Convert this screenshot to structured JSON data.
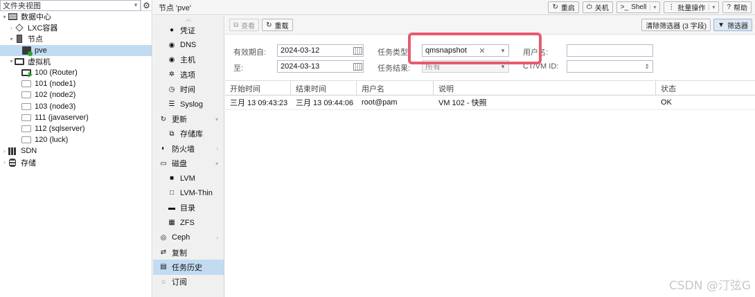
{
  "tree": {
    "view_select": "文件夹视图",
    "nodes": [
      {
        "label": "数据中心",
        "level": 0,
        "icon": "datacenter-icon",
        "expander": "▾"
      },
      {
        "label": "LXC容器",
        "level": 1,
        "icon": "container-icon",
        "expander": "›"
      },
      {
        "label": "节点",
        "level": 1,
        "icon": "server-icon",
        "expander": "▾"
      },
      {
        "label": "pve",
        "level": 2,
        "icon": "node-online-icon",
        "expander": ""
      },
      {
        "label": "虚拟机",
        "level": 1,
        "icon": "monitor-icon",
        "expander": "▾"
      },
      {
        "label": "100 (Router)",
        "level": 2,
        "icon": "vm-running-icon",
        "expander": ""
      },
      {
        "label": "101 (node1)",
        "level": 2,
        "icon": "vm-icon",
        "expander": ""
      },
      {
        "label": "102 (node2)",
        "level": 2,
        "icon": "vm-icon",
        "expander": ""
      },
      {
        "label": "103 (node3)",
        "level": 2,
        "icon": "vm-icon",
        "expander": ""
      },
      {
        "label": "111 (javaserver)",
        "level": 2,
        "icon": "vm-icon",
        "expander": ""
      },
      {
        "label": "112 (sqlserver)",
        "level": 2,
        "icon": "vm-icon",
        "expander": ""
      },
      {
        "label": "120 (luck)",
        "level": 2,
        "icon": "vm-icon",
        "expander": ""
      },
      {
        "label": "SDN",
        "level": 0,
        "icon": "sdn-icon",
        "expander": "›"
      },
      {
        "label": "存储",
        "level": 0,
        "icon": "storage-icon",
        "expander": "›"
      }
    ],
    "selected": "pve"
  },
  "topbar": {
    "title": "节点 'pve'",
    "buttons": [
      {
        "label": "重启",
        "icon": "restart-icon",
        "glyph": "↻"
      },
      {
        "label": "关机",
        "icon": "power-icon",
        "glyph": "⏻"
      },
      {
        "label": "Shell",
        "icon": "terminal-icon",
        "glyph": ">_"
      },
      {
        "label": "批量操作",
        "icon": "bulk-icon",
        "glyph": "⋮"
      },
      {
        "label": "帮助",
        "icon": "help-icon",
        "glyph": "?"
      }
    ]
  },
  "menu": {
    "items": [
      {
        "label": "凭证",
        "icon": "certificate-icon",
        "glyph": "●",
        "level": 1
      },
      {
        "label": "DNS",
        "icon": "globe-icon",
        "glyph": "◉",
        "level": 1
      },
      {
        "label": "主机",
        "icon": "globe-icon",
        "glyph": "◉",
        "level": 1
      },
      {
        "label": "选项",
        "icon": "gear-icon",
        "glyph": "✲",
        "level": 1
      },
      {
        "label": "时间",
        "icon": "clock-icon",
        "glyph": "◷",
        "level": 1
      },
      {
        "label": "Syslog",
        "icon": "list-icon",
        "glyph": "☰",
        "level": 1
      },
      {
        "label": "更新",
        "icon": "refresh-icon",
        "glyph": "↻",
        "level": 0,
        "arrow": "▾"
      },
      {
        "label": "存储库",
        "icon": "repository-icon",
        "glyph": "⧉",
        "level": 1
      },
      {
        "label": "防火墙",
        "icon": "shield-icon",
        "glyph": "◐",
        "level": 0,
        "arrow": "›"
      },
      {
        "label": "磁盘",
        "icon": "disk-icon",
        "glyph": "▭",
        "level": 0,
        "arrow": "▾"
      },
      {
        "label": "LVM",
        "icon": "square-icon",
        "glyph": "■",
        "level": 1
      },
      {
        "label": "LVM-Thin",
        "icon": "square-outline-icon",
        "glyph": "□",
        "level": 1
      },
      {
        "label": "目录",
        "icon": "folder-icon",
        "glyph": "▬",
        "level": 1
      },
      {
        "label": "ZFS",
        "icon": "grid-icon",
        "glyph": "▦",
        "level": 1
      },
      {
        "label": "Ceph",
        "icon": "ceph-icon",
        "glyph": "◎",
        "level": 0,
        "arrow": "›"
      },
      {
        "label": "复制",
        "icon": "replication-icon",
        "glyph": "⇄",
        "level": 0
      },
      {
        "label": "任务历史",
        "icon": "task-list-icon",
        "glyph": "▤",
        "level": 0,
        "active": true
      },
      {
        "label": "订阅",
        "icon": "support-icon",
        "glyph": "◌",
        "level": 0
      }
    ]
  },
  "toolbar": {
    "view_label": "查看",
    "reload_label": "重载",
    "clear_filters_label": "清除筛选器 (3 字段)",
    "filter_label": "筛选器"
  },
  "filters": {
    "since_label": "有效期自:",
    "since_value": "2024-03-12",
    "until_label": "至:",
    "until_value": "2024-03-13",
    "type_label": "任务类型:",
    "type_value": "qmsnapshot",
    "status_label": "任务结果:",
    "status_value": "所有",
    "user_label": "用户名:",
    "user_value": "",
    "vmid_label": "CT/VM ID:",
    "vmid_value": ""
  },
  "grid": {
    "columns": [
      "开始时间",
      "结束时间",
      "用户名",
      "说明",
      "状态"
    ],
    "rows": [
      [
        "三月 13 09:43:23",
        "三月 13 09:44:06",
        "root@pam",
        "VM 102 - 快照",
        "OK"
      ]
    ]
  },
  "watermark": "CSDN @汀弦G",
  "colors": {
    "highlight": "#e85a6d",
    "selected": "#c2dbf1"
  }
}
